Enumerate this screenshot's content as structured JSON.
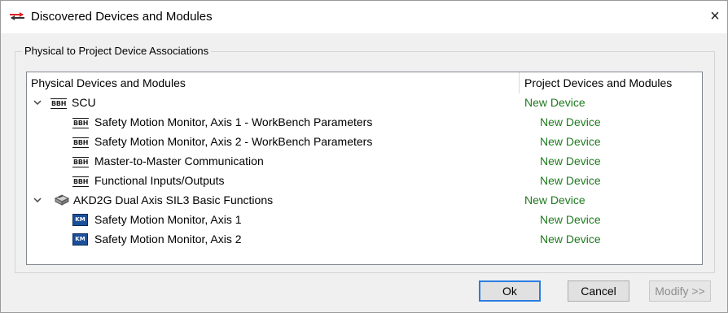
{
  "window": {
    "title": "Discovered Devices and Modules",
    "close_glyph": "×"
  },
  "group": {
    "label": "Physical to Project Device Associations"
  },
  "tree": {
    "columns": [
      "Physical Devices and Modules",
      "Project Devices and Modules"
    ],
    "rows": [
      {
        "level": 0,
        "expanded": true,
        "icon": "BBH",
        "name": "SCU",
        "association": "New Device"
      },
      {
        "level": 1,
        "icon": "BBH",
        "name": "Safety Motion Monitor, Axis 1  - WorkBench Parameters",
        "association": "New Device"
      },
      {
        "level": 1,
        "icon": "BBH",
        "name": "Safety Motion Monitor, Axis 2  - WorkBench Parameters",
        "association": "New Device"
      },
      {
        "level": 1,
        "icon": "BBH",
        "name": "Master-to-Master Communication",
        "association": "New Device"
      },
      {
        "level": 1,
        "icon": "BBH",
        "name": "Functional Inputs/Outputs",
        "association": "New Device"
      },
      {
        "level": 0,
        "expanded": true,
        "icon": "drive-icon",
        "name": "AKD2G Dual Axis SIL3 Basic Functions",
        "association": "New Device"
      },
      {
        "level": 1,
        "icon": "KM",
        "name": "Safety Motion Monitor, Axis 1",
        "association": "New Device"
      },
      {
        "level": 1,
        "icon": "KM",
        "name": "Safety Motion Monitor, Axis 2",
        "association": "New Device"
      }
    ]
  },
  "buttons": {
    "ok": "Ok",
    "cancel": "Cancel",
    "modify": "Modify >>"
  },
  "colors": {
    "association_text": "#1f7a1f",
    "ok_border": "#2a7de1",
    "km_icon": "#1c4f9a"
  }
}
